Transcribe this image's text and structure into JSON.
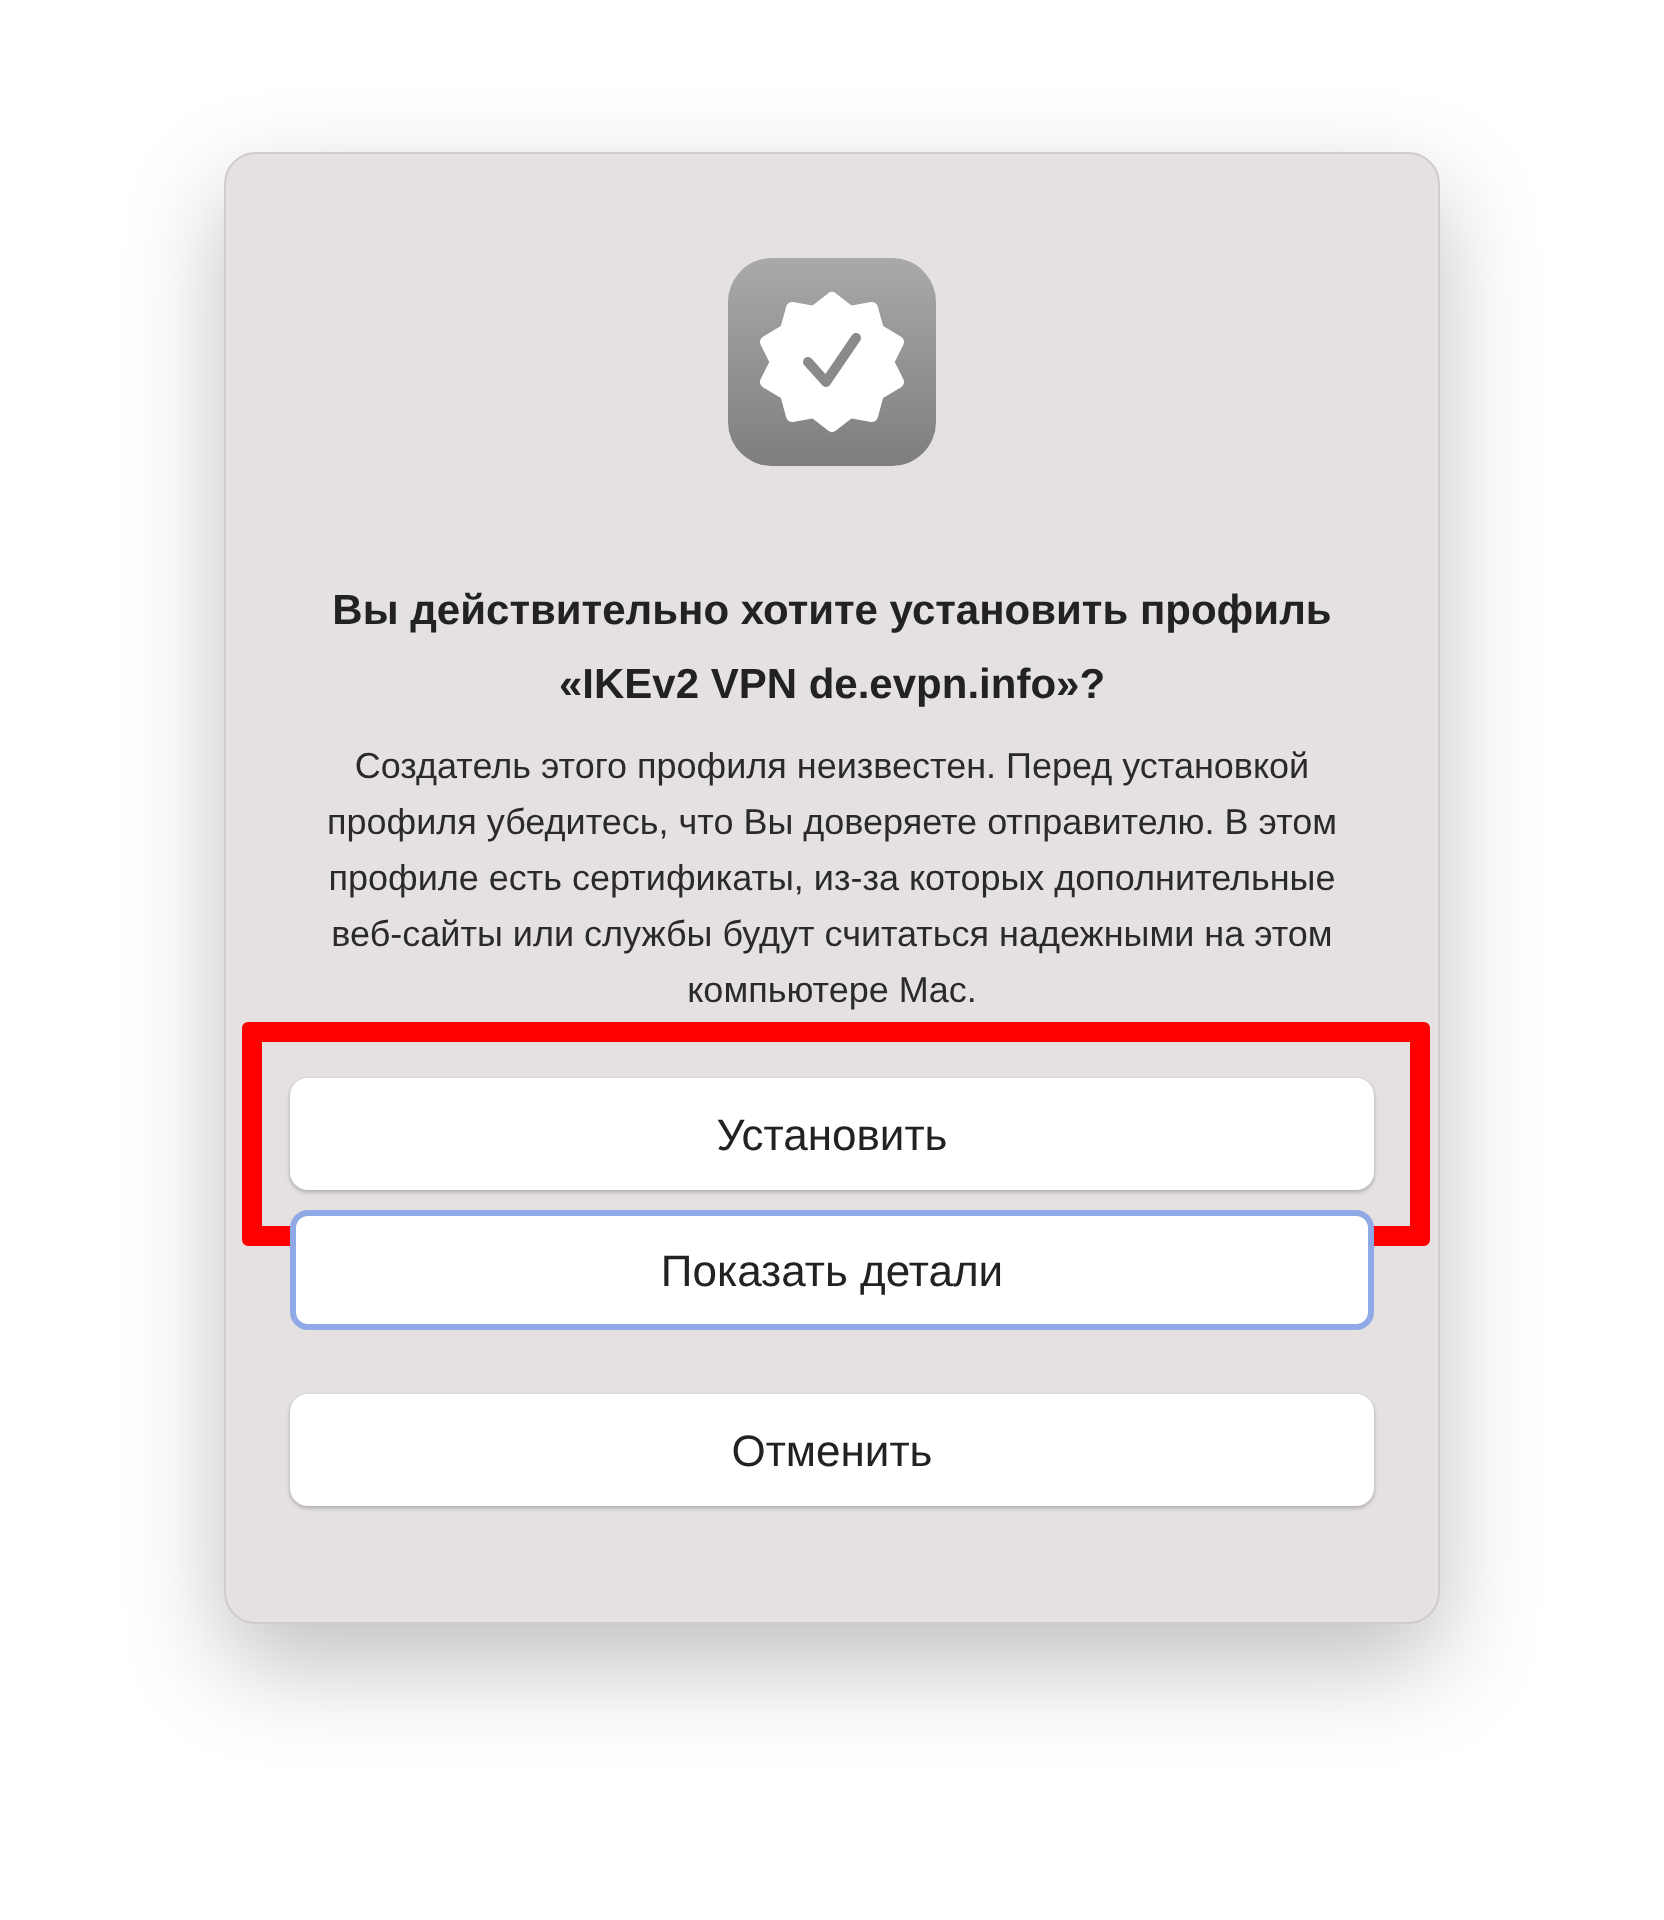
{
  "dialog": {
    "title": "Вы действительно хотите установить профиль «IKEv2 VPN de.evpn.info»?",
    "message": "Создатель этого профиля неизвестен. Перед установкой профиля убедитесь, что Вы доверяете отправителю. В этом профиле есть сертификаты, из-за которых дополнительные веб-сайты или службы будут считаться надежными на этом компьютере Mac.",
    "buttons": [
      {
        "label": "Установить",
        "focused": false,
        "highlighted": true
      },
      {
        "label": "Показать детали",
        "focused": true,
        "highlighted": false
      },
      {
        "label": "Отменить",
        "focused": false,
        "highlighted": false
      }
    ]
  }
}
